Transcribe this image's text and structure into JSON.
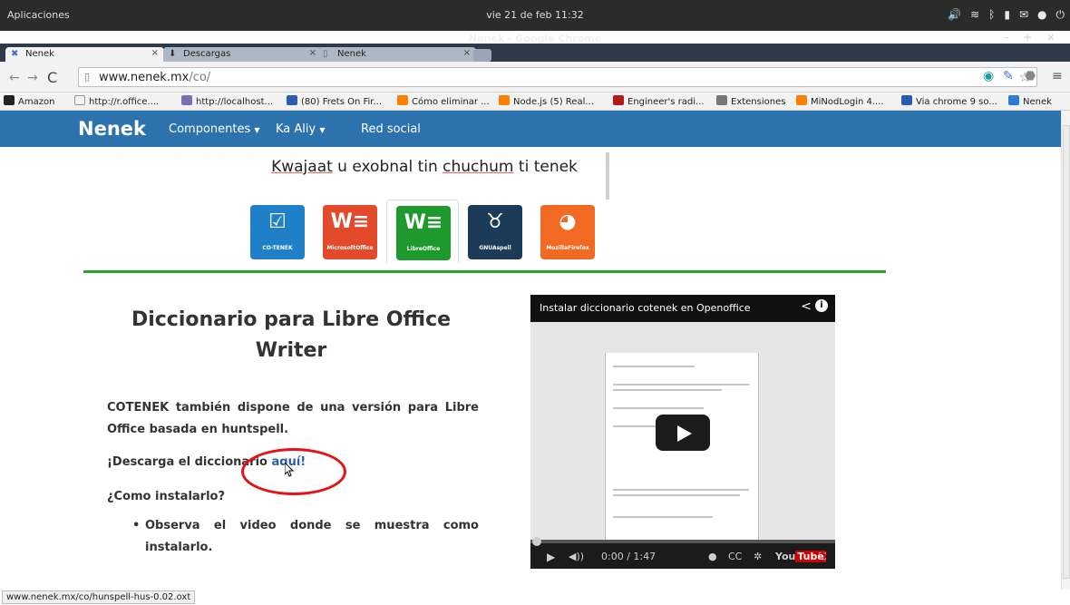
{
  "system": {
    "apps_label": "Aplicaciones",
    "clock": "vie 21 de feb 11:32",
    "window_title": "Nenek - Google Chrome"
  },
  "tabs": [
    {
      "label": "Nenek",
      "active": true
    },
    {
      "label": "Descargas",
      "active": false
    },
    {
      "label": "Nenek",
      "active": false
    }
  ],
  "omnibox": {
    "host": "www.nenek.mx",
    "path": "/co/"
  },
  "bookmarks": [
    {
      "label": "Amazon",
      "color": "#222222"
    },
    {
      "label": "http://r.office....",
      "color": "#ffffff"
    },
    {
      "label": "http://localhost...",
      "color": "#7a6fb0"
    },
    {
      "label": "(80) Frets On Fir...",
      "color": "#2a5db0"
    },
    {
      "label": "Cómo eliminar ...",
      "color": "#ff7f00"
    },
    {
      "label": "Node.js (5) Real...",
      "color": "#ff7f00"
    },
    {
      "label": "Engineer's radi...",
      "color": "#b01a1a"
    },
    {
      "label": "Extensiones",
      "color": "#555555"
    },
    {
      "label": "MiNodLogin 4....",
      "color": "#ff7f00"
    },
    {
      "label": "Via chrome 9 so...",
      "color": "#2a5db0"
    },
    {
      "label": "Nenek",
      "color": "#2a7dd0"
    }
  ],
  "site": {
    "brand": "Nenek",
    "nav": [
      "Componentes",
      "Ka Aliy",
      "Red social"
    ],
    "banner": {
      "part1": "Kwajaat",
      "part2": " u exobnal tin ",
      "part3": "chuchum",
      "part4": " ti tenek"
    },
    "apps": [
      {
        "label": "CO-TENEK",
        "color": "#1f80c8"
      },
      {
        "label": "MicrosoftOffice",
        "color": "#e34a2b"
      },
      {
        "label": "LibreOffice",
        "color": "#1e9a2c"
      },
      {
        "label": "GNUAspell",
        "color": "#1b3b58"
      },
      {
        "label": "MozillaFirefox",
        "color": "#f26a21"
      }
    ],
    "title": "Diccionario para Libre Office Writer",
    "para1": "COTENEK también dispone de una versión para Libre Office basada en huntspell.",
    "download_prefix": "¡Descarga el diccionario ",
    "download_link": "aquí!",
    "how_to": "¿Como instalarlo?",
    "bullet": "Observa el video donde se muestra como instalarlo."
  },
  "video": {
    "title": "Instalar diccionario cotenek en Openoffice",
    "time": "0:00 / 1:47"
  },
  "status_url": "www.nenek.mx/co/hunspell-hus-0.02.oxt"
}
